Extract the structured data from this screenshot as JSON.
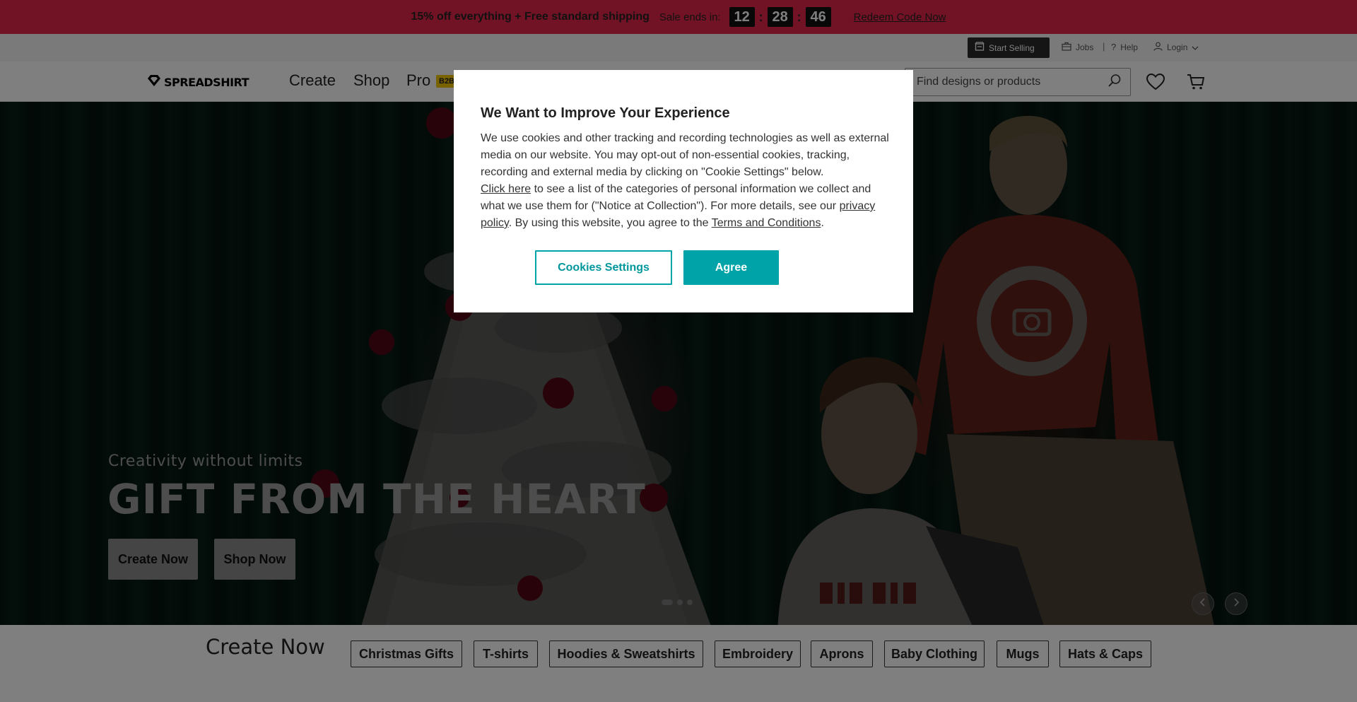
{
  "promo": {
    "text": "15% off everything + Free standard shipping",
    "sale_ends_label": "Sale ends in:",
    "timer": {
      "hours": "12",
      "minutes": "28",
      "seconds": "46",
      "separator": ":"
    },
    "redeem_label": "Redeem Code Now",
    "color": "#e2264a"
  },
  "utility": {
    "start_selling": "Start Selling",
    "jobs": "Jobs",
    "separator": "|",
    "help": "Help",
    "login": "Login"
  },
  "nav": {
    "logo": "SPREADSHIRT",
    "items": [
      "Create",
      "Shop",
      "Pro"
    ],
    "b2b_badge": "B2B",
    "search_placeholder": "Find designs or products"
  },
  "hero": {
    "subtitle": "Creativity without limits",
    "title": "GIFT FROM THE HEART",
    "create_button": "Create Now",
    "shop_button": "Shop Now",
    "slide_count": 3,
    "active_slide": 1,
    "woman_print": "YOUR PHOTO HERE",
    "man_print": "BIG NICK ENERGY"
  },
  "create_strip": {
    "title": "Create Now",
    "chips": [
      "Christmas Gifts",
      "T-shirts",
      "Hoodies & Sweatshirts",
      "Embroidery",
      "Aprons",
      "Baby Clothing",
      "Mugs",
      "Hats & Caps"
    ]
  },
  "cookie_modal": {
    "title": "We Want to Improve Your Experience",
    "text_1": "We use cookies and other tracking and recording technologies as well as external media on our website. You may opt-out of non-essential cookies, tracking, recording and external media by clicking on \"Cookie Settings\" below.",
    "link_click_here": "Click here",
    "text_2": " to see a list of the categories of personal information we collect and what we use them for (\"Notice at Collection\"). For more details, see our ",
    "link_privacy": "privacy policy",
    "text_3": ". By using this website, you agree to the ",
    "link_terms": "Terms and Conditions",
    "text_4": ".",
    "settings_button": "Cookies Settings",
    "agree_button": "Agree",
    "accent_color": "#00a3a8"
  }
}
